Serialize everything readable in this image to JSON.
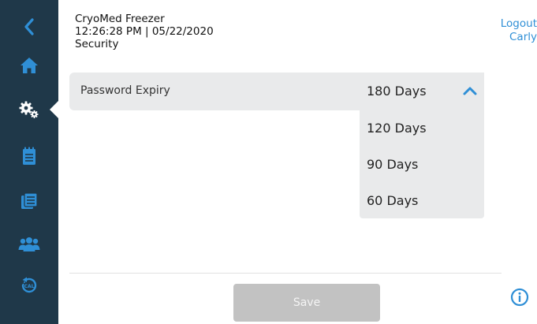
{
  "header": {
    "app_name": "CryoMed Freezer",
    "datetime": "12:26:28 PM | 05/22/2020",
    "section": "Security"
  },
  "user": {
    "logout_label": "Logout",
    "username": "Carly"
  },
  "sidebar": {
    "items": [
      {
        "name": "back",
        "icon": "chevron-left-icon"
      },
      {
        "name": "home",
        "icon": "home-icon"
      },
      {
        "name": "settings",
        "icon": "gears-icon",
        "active": true
      },
      {
        "name": "notepad",
        "icon": "notepad-icon"
      },
      {
        "name": "logs",
        "icon": "logbook-icon"
      },
      {
        "name": "users",
        "icon": "users-icon"
      },
      {
        "name": "calibration",
        "icon": "calibration-icon"
      }
    ]
  },
  "setting": {
    "label": "Password Expiry",
    "selected": "180 Days",
    "options": [
      "180 Days",
      "120 Days",
      "90 Days",
      "60 Days"
    ]
  },
  "actions": {
    "save_label": "Save",
    "info_icon": "info-icon"
  },
  "colors": {
    "sidebar_bg": "#1f3849",
    "accent": "#2f8fd6",
    "row_bg": "#e9eaeb",
    "save_disabled": "#c2c2c2"
  }
}
